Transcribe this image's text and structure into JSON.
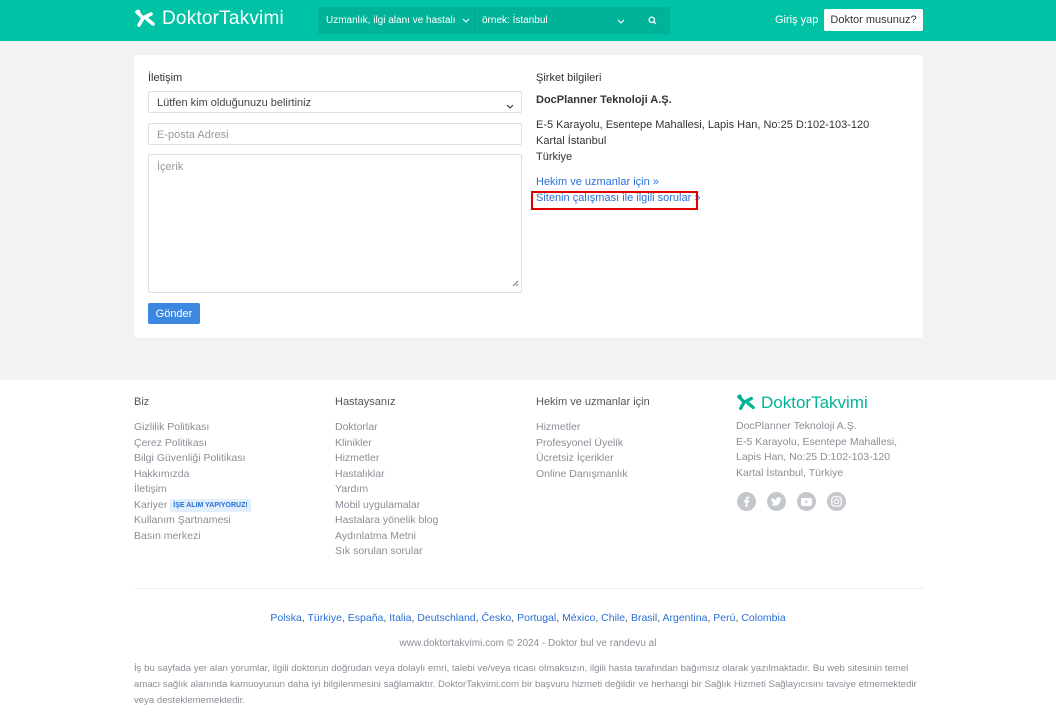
{
  "header": {
    "logo": "DoktorTakvimi",
    "search_specialty": "Uzmanlık, ilgi alanı ve hastalı",
    "search_location": "örnek: İstanbul",
    "login": "Giriş yap",
    "doctor_button": "Doktor musunuz?"
  },
  "contact": {
    "title": "İletişim",
    "select_value": "Lütfen kim olduğunuzu belirtiniz",
    "email_placeholder": "E-posta Adresi",
    "content_placeholder": "İçerik",
    "submit": "Gönder"
  },
  "company": {
    "title": "Şirket bilgileri",
    "name": "DocPlanner Teknoloji A.Ş.",
    "address_line1": "E-5 Karayolu, Esentepe Mahallesi, Lapis Han, No:25 D:102-103-120",
    "address_line2": "Kartal İstanbul",
    "address_line3": "Türkiye",
    "link_doctors": "Hekim ve uzmanlar için »",
    "link_site_faq": "Sitenin çalışması ile ilgili sorular »"
  },
  "footer": {
    "col1": {
      "title": "Biz",
      "items": [
        "Gizlilik Politikası",
        "Çerez Politikası",
        "Bilgi Güvenliği Politikası",
        "Hakkımızda",
        "İletişim",
        "Kariyer",
        "Kullanım Şartnamesi",
        "Basın merkezi"
      ],
      "badge": "İŞE ALIM YAPIYORUZ!"
    },
    "col2": {
      "title": "Hastaysanız",
      "items": [
        "Doktorlar",
        "Klinikler",
        "Hizmetler",
        "Hastalıklar",
        "Yardım",
        "Mobil uygulamalar",
        "Hastalara yönelik blog",
        "Aydınlatma Metni",
        "Sık sorulan sorular"
      ]
    },
    "col3": {
      "title": "Hekim ve uzmanlar için",
      "items": [
        "Hizmetler",
        "Profesyonel Üyelik",
        "Ücretsiz İçerikler",
        "Online Danışmanlık"
      ]
    },
    "brand": {
      "logo": "DoktorTakvimi",
      "lines": [
        "DocPlanner Teknoloji A.Ş.",
        "E-5 Karayolu, Esentepe Mahallesi,",
        "Lapis Han, No:25 D:102-103-120",
        "Kartal İstanbul, Türkiye"
      ],
      "social_icons": [
        "facebook-icon",
        "twitter-icon",
        "youtube-icon",
        "instagram-icon"
      ]
    },
    "countries": [
      "Polska",
      "Türkiye",
      "España",
      "Italia",
      "Deutschland",
      "Česko",
      "Portugal",
      "México",
      "Chile",
      "Brasil",
      "Argentina",
      "Perú",
      "Colombia"
    ],
    "copyright": "www.doktortakvimi.com © 2024 - Doktor bul ve randevu al",
    "disclaimer": "İş bu sayfada yer alan yorumlar, ilgili doktorun doğrudan veya dolaylı emri, talebi ve/veya ricası olmaksızın, ilgili hasta tarafından bağımsız olarak yazılmaktadır. Bu web sitesinin temel amacı sağlık alanında kamuoyunun daha iyi bilgilenmesini sağlamaktır. DoktorTakvimi.com bir başvuru hizmeti değildir ve herhangi bir Sağlık Hizmeti Sağlayıcısını tavsiye etmemektedir veya desteklememektedir."
  },
  "colors": {
    "brand": "#00c3a5",
    "link": "#2a6fd6",
    "button": "#3c87e0",
    "highlight": "#e00000"
  }
}
